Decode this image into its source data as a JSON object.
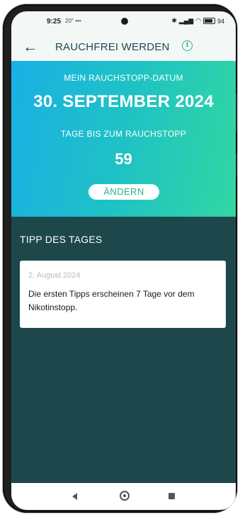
{
  "status_bar": {
    "time": "9:25",
    "extra": "20° •••",
    "battery": "94"
  },
  "app_bar": {
    "title": "RAUCHFREI WERDEN",
    "back_icon": "arrow-left-icon",
    "info_icon": "info-circle-icon"
  },
  "hero": {
    "date_label": "MEIN RAUCHSTOPP-DATUM",
    "date": "30. SEPTEMBER 2024",
    "days_label": "TAGE BIS ZUM RAUCHSTOPP",
    "days": "59",
    "change_button": "ÄNDERN",
    "gradient_colors": [
      "#1ab0e6",
      "#1fc2c4",
      "#31d7a2"
    ]
  },
  "tip": {
    "heading": "TIPP DES TAGES",
    "date": "2. August 2024",
    "text": "Die ersten Tipps erscheinen 7 Tage vor dem Nikotinstopp."
  },
  "nav_bar": {
    "back_icon": "triangle-back-icon",
    "home_icon": "circle-home-icon",
    "recents_icon": "square-recents-icon"
  },
  "colors": {
    "accent": "#22b58a",
    "background": "#1e474c",
    "app_bar": "#f3f7f6",
    "title": "#1e4a4f"
  }
}
